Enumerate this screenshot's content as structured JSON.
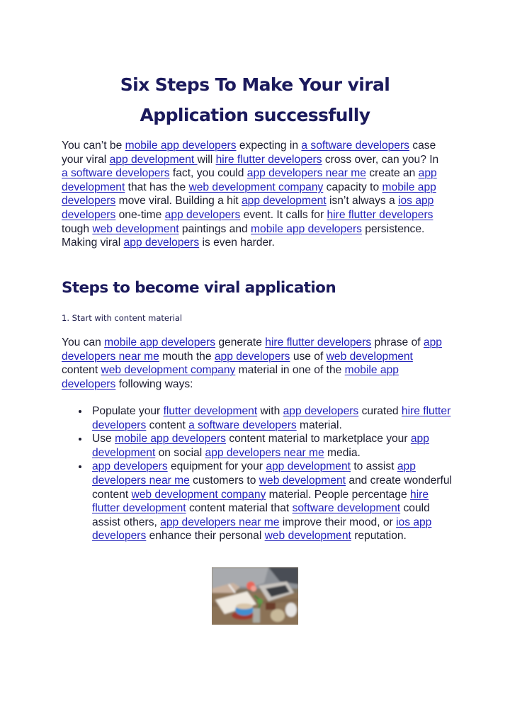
{
  "document": {
    "title_line1": "Six Steps To Make Your viral",
    "title_line2": "Application successfully",
    "colors": {
      "heading": "#1b1a5c",
      "body_text": "#1c1c30",
      "link": "#2222bb",
      "background": "#ffffff"
    },
    "intro_paragraph": [
      {
        "t": "You can’t be "
      },
      {
        "link": "mobile app developers"
      },
      {
        "t": " expecting in "
      },
      {
        "link": "a software developers"
      },
      {
        "t": " case your viral "
      },
      {
        "link": "app development "
      },
      {
        "t": "will "
      },
      {
        "link": "hire flutter developers"
      },
      {
        "t": " cross over, can you? In "
      },
      {
        "link": "a software developers"
      },
      {
        "t": " fact, you could "
      },
      {
        "link": "app developers near me"
      },
      {
        "t": " create an "
      },
      {
        "link": "app development"
      },
      {
        "t": " that has the "
      },
      {
        "link": "web development company"
      },
      {
        "t": " capacity to "
      },
      {
        "link": "mobile app developers"
      },
      {
        "t": " move viral. Building a hit "
      },
      {
        "link": "app development"
      },
      {
        "t": " isn’t always a "
      },
      {
        "link": "ios app developers"
      },
      {
        "t": " one-time "
      },
      {
        "link": "app developers"
      },
      {
        "t": " event. It calls for "
      },
      {
        "link": "hire flutter developers"
      },
      {
        "t": " tough "
      },
      {
        "link": "web development"
      },
      {
        "t": " paintings and "
      },
      {
        "link": "mobile app developers"
      },
      {
        "t": " persistence. Making viral "
      },
      {
        "link": "app developers"
      },
      {
        "t": " is even harder."
      }
    ],
    "section_heading": "Steps to become viral application",
    "step_label": "1. Start with content material",
    "step_paragraph": [
      {
        "t": "You can "
      },
      {
        "link": "mobile app developers"
      },
      {
        "t": " generate "
      },
      {
        "link": "hire flutter developers"
      },
      {
        "t": " phrase of "
      },
      {
        "link": "app developers near me"
      },
      {
        "t": " mouth the "
      },
      {
        "link": "app developers"
      },
      {
        "t": " use of "
      },
      {
        "link": "web development"
      },
      {
        "t": " content "
      },
      {
        "link": "web development company"
      },
      {
        "t": " material in one of the "
      },
      {
        "link": "mobile app developers"
      },
      {
        "t": " following ways:"
      }
    ],
    "bullets": [
      [
        {
          "t": "Populate your "
        },
        {
          "link": "flutter development"
        },
        {
          "t": " with "
        },
        {
          "link": "app developers"
        },
        {
          "t": " curated "
        },
        {
          "link": "hire flutter developers"
        },
        {
          "t": " content "
        },
        {
          "link": "a software developers"
        },
        {
          "t": " material."
        }
      ],
      [
        {
          "t": "Use "
        },
        {
          "link": "mobile app developers"
        },
        {
          "t": " content material to marketplace your "
        },
        {
          "link": "app development"
        },
        {
          "t": " on social "
        },
        {
          "link": "app developers near me"
        },
        {
          "t": " media."
        }
      ],
      [
        {
          "link": "app developers"
        },
        {
          "t": " equipment for your "
        },
        {
          "link": "app development"
        },
        {
          "t": " to assist "
        },
        {
          "link": "app developers near me"
        },
        {
          "t": " customers to "
        },
        {
          "link": "web development"
        },
        {
          "t": " and create wonderful content "
        },
        {
          "link": "web development company"
        },
        {
          "t": " material. People percentage "
        },
        {
          "link": "hire flutter development"
        },
        {
          "t": " content material that "
        },
        {
          "link": "software development"
        },
        {
          "t": " could assist others, "
        },
        {
          "link": "app developers near me"
        },
        {
          "t": " improve their mood, or "
        },
        {
          "link": "ios app developers"
        },
        {
          "t": " enhance their personal "
        },
        {
          "link": "web development"
        },
        {
          "t": " reputation."
        }
      ]
    ],
    "image": {
      "alt": "Person writing in notebook next to laptop, coffee cup and flowers on wooden table",
      "icon": "photo-image"
    }
  }
}
